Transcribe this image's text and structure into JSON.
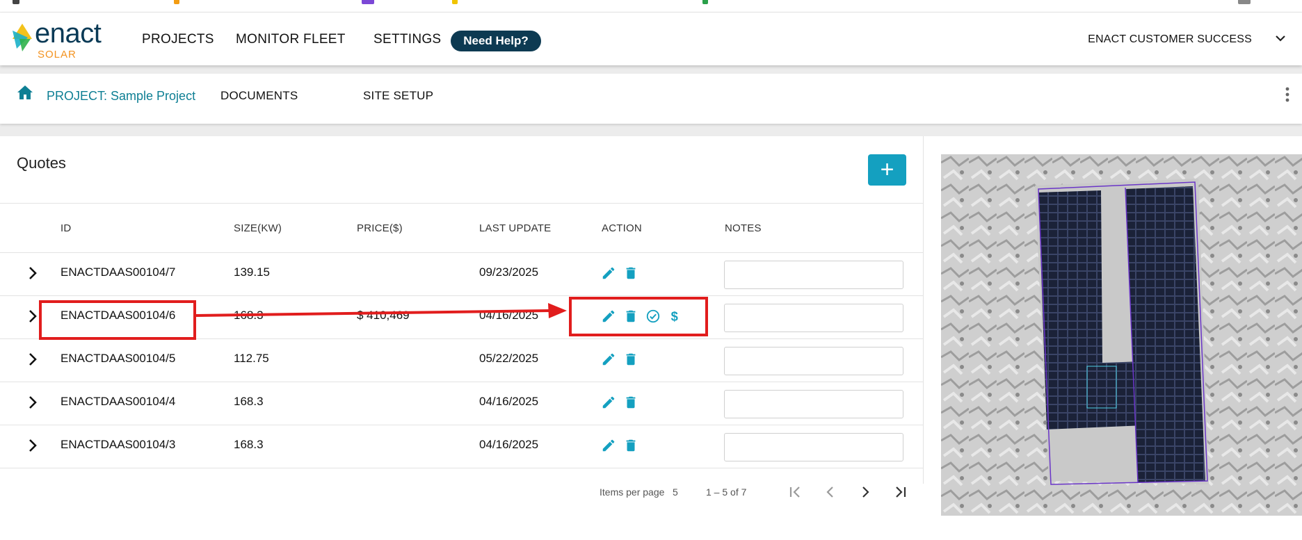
{
  "header": {
    "logo_word": "enact",
    "logo_sub": "SOLAR",
    "nav": [
      "PROJECTS",
      "MONITOR FLEET",
      "SETTINGS"
    ],
    "help_label": "Need Help?",
    "account_label": "ENACT CUSTOMER SUCCESS"
  },
  "subnav": {
    "project_label": "PROJECT: Sample Project",
    "documents_label": "DOCUMENTS",
    "site_setup_label": "SITE SETUP"
  },
  "quotes": {
    "title": "Quotes",
    "add_label": "+",
    "columns": {
      "id": "ID",
      "size": "SIZE(KW)",
      "price": "PRICE($)",
      "last_update": "LAST UPDATE",
      "action": "ACTION",
      "notes": "NOTES"
    },
    "rows": [
      {
        "id": "ENACTDAAS00104/7",
        "size": "139.15",
        "price": "",
        "date": "09/23/2025"
      },
      {
        "id": "ENACTDAAS00104/6",
        "size": "168.3",
        "price": "$ 410,469",
        "date": "04/16/2025"
      },
      {
        "id": "ENACTDAAS00104/5",
        "size": "112.75",
        "price": "",
        "date": "05/22/2025"
      },
      {
        "id": "ENACTDAAS00104/4",
        "size": "168.3",
        "price": "",
        "date": "04/16/2025"
      },
      {
        "id": "ENACTDAAS00104/3",
        "size": "168.3",
        "price": "",
        "date": "04/16/2025"
      }
    ]
  },
  "paginator": {
    "items_per_page_label": "Items per page",
    "items_per_page_value": "5",
    "range_label": "1 – 5 of 7"
  },
  "colors": {
    "accent": "#14a0c0",
    "link": "#0e7f94",
    "brand_navy": "#0d3a52",
    "annotation": "#e11d1d"
  }
}
